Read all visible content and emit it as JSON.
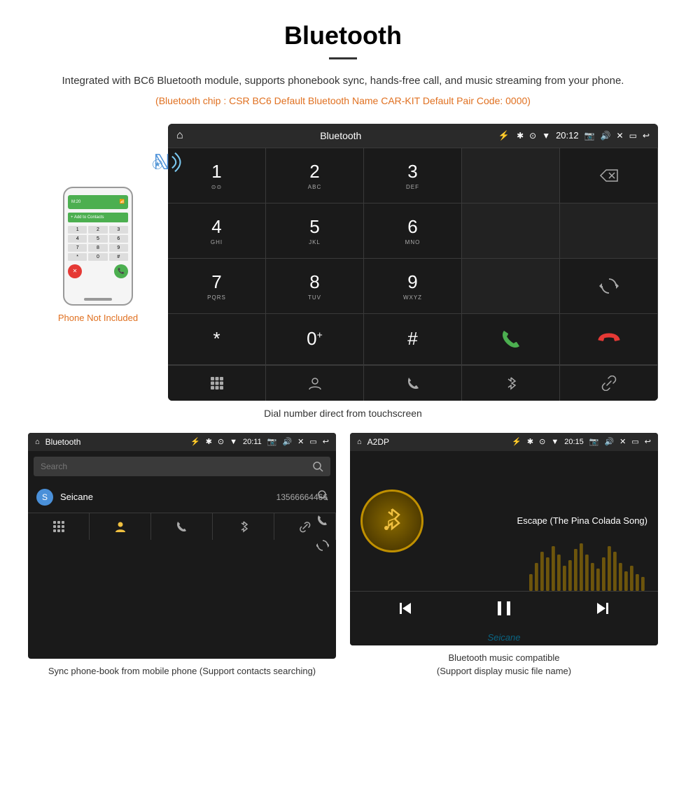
{
  "page": {
    "title": "Bluetooth",
    "subtitle": "Integrated with BC6 Bluetooth module, supports phonebook sync, hands-free call, and music streaming from your phone.",
    "bluetooth_info": "(Bluetooth chip : CSR BC6    Default Bluetooth Name CAR-KIT    Default Pair Code: 0000)",
    "dial_caption": "Dial number direct from touchscreen",
    "phone_not_included": "Phone Not Included",
    "caption_phonebook": "Sync phone-book from mobile phone\n(Support contacts searching)",
    "caption_music": "Bluetooth music compatible\n(Support display music file name)"
  },
  "dialer": {
    "header_title": "Bluetooth",
    "time": "20:12",
    "keys": [
      {
        "num": "1",
        "sub": "⊙⊙"
      },
      {
        "num": "2",
        "sub": "ABC"
      },
      {
        "num": "3",
        "sub": "DEF"
      },
      {
        "num": "",
        "sub": ""
      },
      {
        "num": "⌫",
        "sub": ""
      },
      {
        "num": "4",
        "sub": "GHI"
      },
      {
        "num": "5",
        "sub": "JKL"
      },
      {
        "num": "6",
        "sub": "MNO"
      },
      {
        "num": "",
        "sub": ""
      },
      {
        "num": "",
        "sub": ""
      },
      {
        "num": "7",
        "sub": "PQRS"
      },
      {
        "num": "8",
        "sub": "TUV"
      },
      {
        "num": "9",
        "sub": "WXYZ"
      },
      {
        "num": "",
        "sub": ""
      },
      {
        "num": "↺",
        "sub": ""
      },
      {
        "num": "*",
        "sub": ""
      },
      {
        "num": "0",
        "sub": "+"
      },
      {
        "num": "#",
        "sub": ""
      },
      {
        "num": "📞",
        "sub": ""
      },
      {
        "num": "📞end",
        "sub": ""
      }
    ]
  },
  "phonebook": {
    "header_title": "Bluetooth",
    "time": "20:11",
    "search_placeholder": "Search",
    "contact_name": "Seicane",
    "contact_number": "13566664466",
    "contact_letter": "S"
  },
  "music": {
    "header_title": "A2DP",
    "time": "20:15",
    "song_title": "Escape (The Pina Colada Song)"
  },
  "colors": {
    "accent_orange": "#e07020",
    "screen_bg": "#1a1a1a",
    "screen_header": "#2a2a2a",
    "call_green": "#4caf50",
    "call_red": "#e53935",
    "bt_blue": "#2196f3"
  }
}
